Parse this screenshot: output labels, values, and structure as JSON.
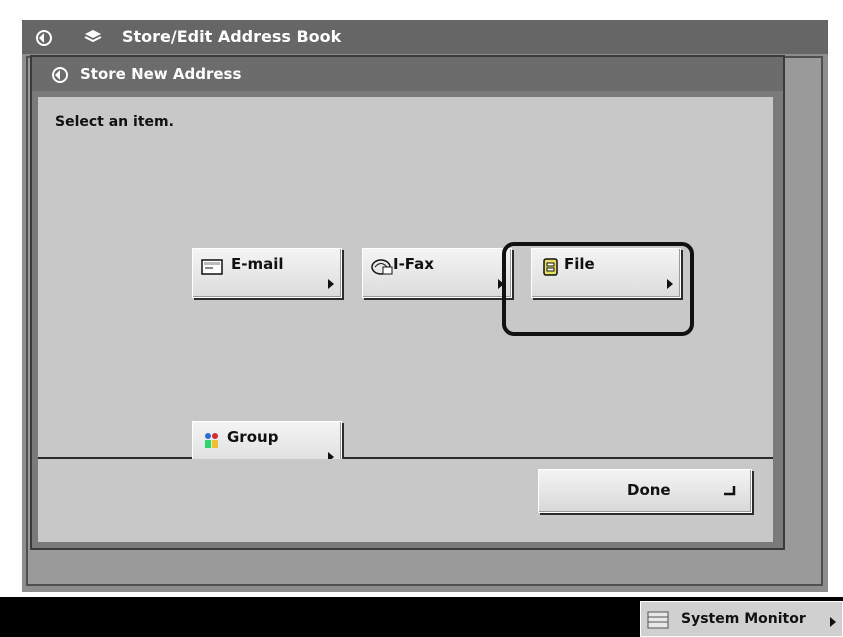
{
  "window": {
    "title": "Store/Edit Address Book",
    "icons": [
      "settings-icon",
      "address-book-icon"
    ]
  },
  "dialog": {
    "title": "Store New Address",
    "prompt": "Select an item."
  },
  "items": [
    {
      "label": "E-mail",
      "icon": "email-icon"
    },
    {
      "label": "I-Fax",
      "icon": "ifax-icon"
    },
    {
      "label": "File",
      "icon": "file-icon",
      "highlighted": true
    },
    {
      "label": "Group",
      "icon": "group-icon"
    }
  ],
  "footer": {
    "done_label": "Done",
    "done_icon": "enter-icon"
  },
  "system_monitor": {
    "label": "System Monitor",
    "icon": "monitor-icon"
  }
}
